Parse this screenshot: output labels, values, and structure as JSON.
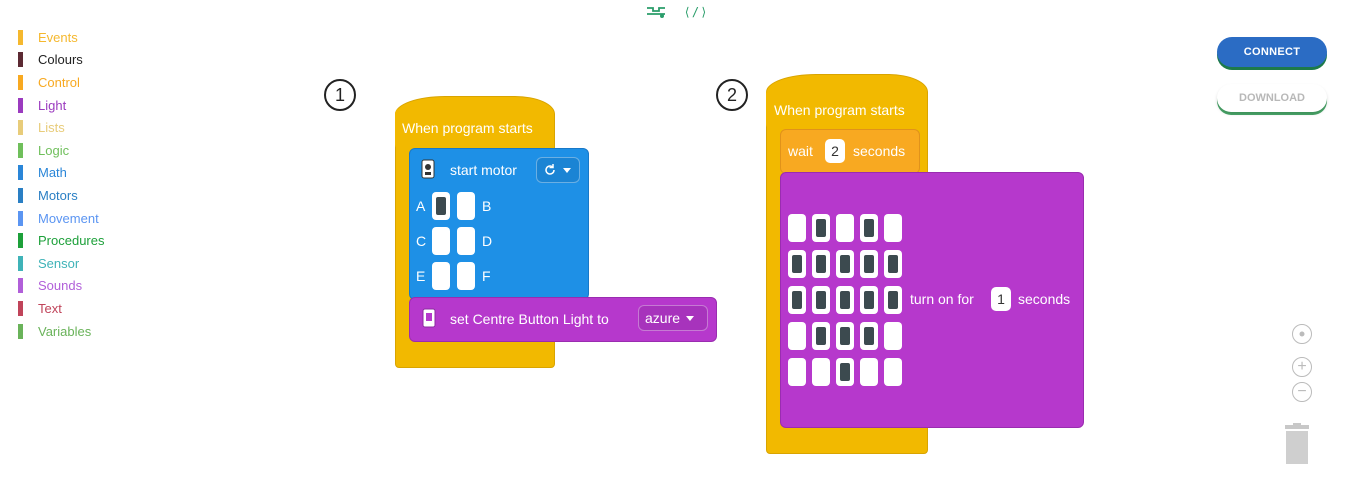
{
  "toolbar": {
    "view_blocks_icon": "blocks-view-icon",
    "view_code_icon": "code-view-icon",
    "code_glyph": "⟨/⟩"
  },
  "categories": [
    {
      "label": "Events",
      "color": "#f5b82e"
    },
    {
      "label": "Colours",
      "color": "#5c2a33"
    },
    {
      "label": "Control",
      "color": "#f8a921"
    },
    {
      "label": "Light",
      "color": "#9b3bbf"
    },
    {
      "label": "Lists",
      "color": "#e8cc7a"
    },
    {
      "label": "Logic",
      "color": "#6fbf5b"
    },
    {
      "label": "Math",
      "color": "#2a86d8"
    },
    {
      "label": "Motors",
      "color": "#2a7fc4"
    },
    {
      "label": "Movement",
      "color": "#5b95f2"
    },
    {
      "label": "Procedures",
      "color": "#1da03a"
    },
    {
      "label": "Sensor",
      "color": "#3fb3b8"
    },
    {
      "label": "Sounds",
      "color": "#b15fd9"
    },
    {
      "label": "Text",
      "color": "#c0445a"
    },
    {
      "label": "Variables",
      "color": "#6ab35a"
    }
  ],
  "buttons": {
    "connect": "CONNECT",
    "download": "DOWNLOAD"
  },
  "program1": {
    "step": "1",
    "hat": "When program starts",
    "start_motor": "start motor",
    "ports": [
      "A",
      "B",
      "C",
      "D",
      "E",
      "F"
    ],
    "ports_selected": [
      true,
      false,
      false,
      false,
      false,
      false
    ],
    "set_light": "set Centre Button Light to",
    "light_color": "azure"
  },
  "program2": {
    "step": "2",
    "hat": "When program starts",
    "wait_label": "wait",
    "wait_value": "2",
    "seconds": "seconds",
    "turn_on_for": "turn on for",
    "turn_on_value": "1",
    "leds": [
      [
        0,
        1,
        0,
        1,
        0
      ],
      [
        1,
        1,
        1,
        1,
        1
      ],
      [
        1,
        1,
        1,
        1,
        1
      ],
      [
        0,
        1,
        1,
        1,
        0
      ],
      [
        0,
        0,
        1,
        0,
        0
      ]
    ]
  },
  "workspace": {
    "recenter_icon": "recenter-icon",
    "zoom_in": "+",
    "zoom_out": "−",
    "trash_icon": "trash-icon"
  }
}
